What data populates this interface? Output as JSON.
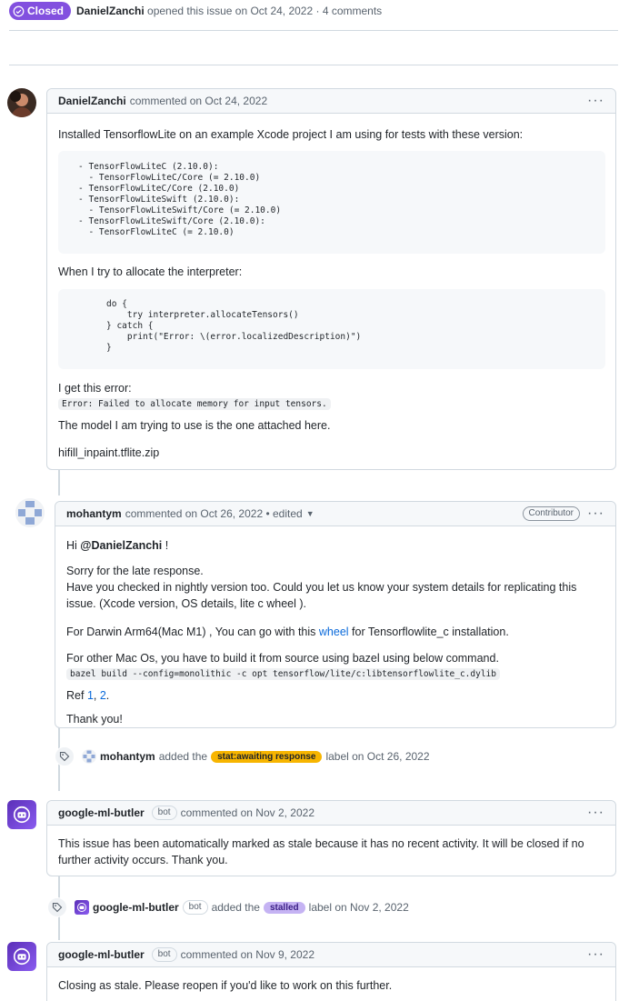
{
  "header": {
    "status_label": "Closed",
    "author": "DanielZanchi",
    "meta_text": "opened this issue on Oct 24, 2022 · 4 comments"
  },
  "comments": [
    {
      "author": "DanielZanchi",
      "action": "commented on Oct 24, 2022",
      "menu": "···",
      "intro": "Installed TensorflowLite on an example Xcode project I am using for tests with these version:",
      "code1": "- TensorFlowLiteC (2.10.0):\n  - TensorFlowLiteC/Core (= 2.10.0)\n- TensorFlowLiteC/Core (2.10.0)\n- TensorFlowLiteSwift (2.10.0):\n  - TensorFlowLiteSwift/Core (= 2.10.0)\n- TensorFlowLiteSwift/Core (2.10.0):\n  - TensorFlowLiteC (= 2.10.0)",
      "para2": "When I try to allocate the interpreter:",
      "code2": "do {\n    try interpreter.allocateTensors()\n} catch {\n    print(\"Error: \\(error.localizedDescription)\")\n}",
      "para3": "I get this error:",
      "error_code": "Error: Failed to allocate memory for input tensors.",
      "para4": "The model I am trying to use is the one attached here.",
      "attachment": "hifill_inpaint.tflite.zip"
    },
    {
      "author": "mohantym",
      "action": "commented on Oct 26, 2022 • edited",
      "role": "Contributor",
      "menu": "···",
      "greet_prefix": "Hi ",
      "greet_mention": "@DanielZanchi",
      "greet_suffix": " !",
      "line1": "Sorry for the late response.",
      "line2": "Have you checked in nightly version too. Could you let us know your system details for replicating this issue. (Xcode version, OS details, lite c wheel ).",
      "darwin_prefix": "For Darwin Arm64(Mac M1) , You can go with this ",
      "darwin_link": "wheel",
      "darwin_suffix": " for Tensorflowlite_c installation.",
      "other_mac": "For other Mac Os, you have to build it from source using bazel using below command.",
      "bazel_cmd": "bazel build --config=monolithic -c opt tensorflow/lite/c:libtensorflowlite_c.dylib",
      "ref_prefix": "Ref ",
      "ref1": "1",
      "ref_sep": ", ",
      "ref2": "2",
      "ref_suffix": ".",
      "thanks": "Thank you!"
    },
    {
      "author": "google-ml-butler",
      "bot": "bot",
      "action": "commented on Nov 2, 2022",
      "menu": "···",
      "text": "This issue has been automatically marked as stale because it has no recent activity. It will be closed if no further activity occurs. Thank you."
    },
    {
      "author": "google-ml-butler",
      "bot": "bot",
      "action": "commented on Nov 9, 2022",
      "menu": "···",
      "text": "Closing as stale. Please reopen if you'd like to work on this further."
    }
  ],
  "events": [
    {
      "actor": "mohantym",
      "prefix": "added the",
      "label": "stat:awaiting response",
      "suffix": "label on Oct 26, 2022",
      "label_color": "#f7b500"
    },
    {
      "actor": "google-ml-butler",
      "bot": "bot",
      "prefix": "added the",
      "label": "stalled",
      "suffix": "label on Nov 2, 2022",
      "label_color": "#c5b3f3"
    }
  ],
  "colors": {
    "closed_purple": "#8250df",
    "link_blue": "#0969da",
    "border": "#d1d9e0"
  }
}
